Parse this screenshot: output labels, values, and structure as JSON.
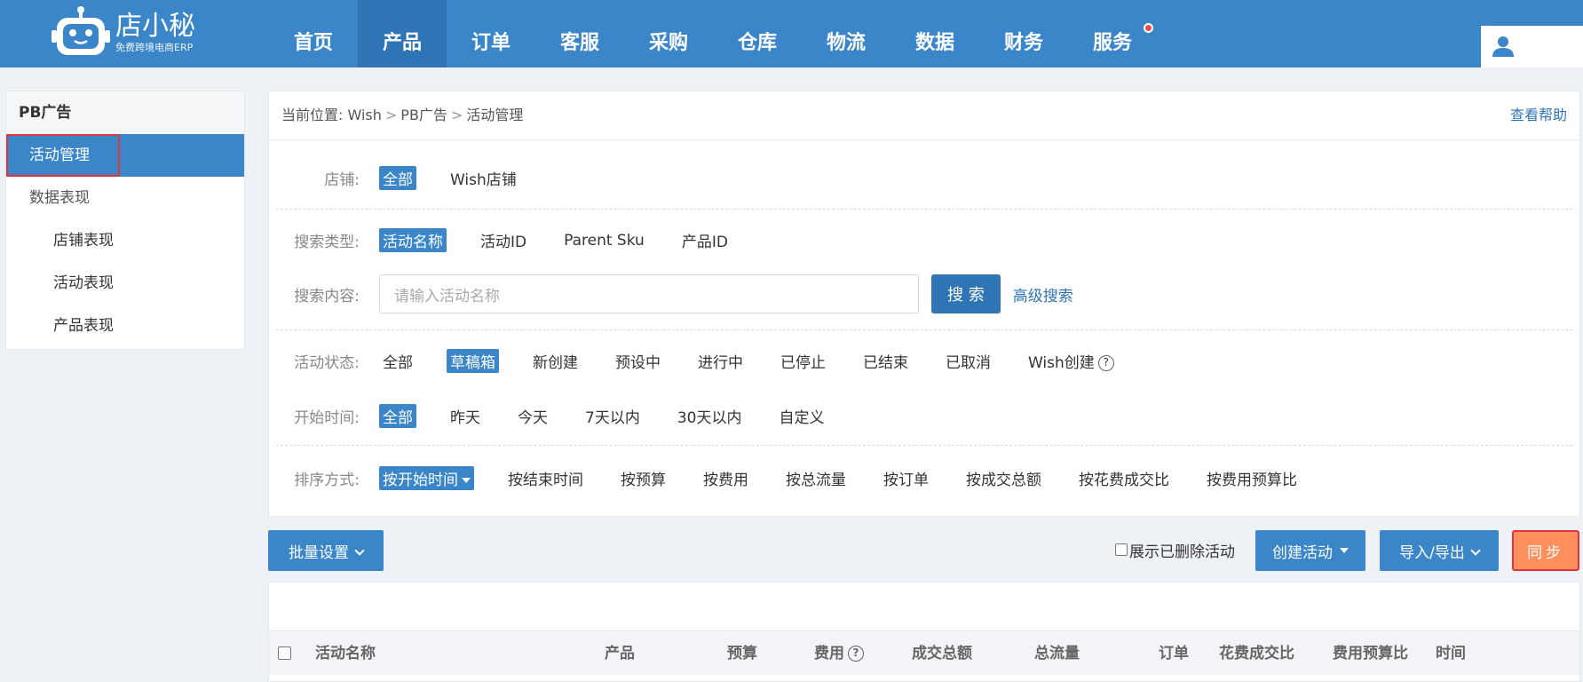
{
  "brand": {
    "name": "店小秘",
    "tagline": "免费跨境电商ERP"
  },
  "nav": {
    "items": [
      {
        "label": "首页"
      },
      {
        "label": "产品",
        "active": true
      },
      {
        "label": "订单"
      },
      {
        "label": "客服"
      },
      {
        "label": "采购"
      },
      {
        "label": "仓库"
      },
      {
        "label": "物流"
      },
      {
        "label": "数据"
      },
      {
        "label": "财务"
      },
      {
        "label": "服务",
        "badge_dot": true
      }
    ]
  },
  "sidebar": {
    "title": "PB广告",
    "items": [
      {
        "label": "活动管理",
        "active": true
      },
      {
        "label": "数据表现"
      },
      {
        "label": "店铺表现"
      },
      {
        "label": "活动表现"
      },
      {
        "label": "产品表现"
      }
    ]
  },
  "breadcrumb": {
    "prefix": "当前位置:",
    "items": [
      "Wish",
      "PB广告",
      "活动管理"
    ],
    "help": "查看帮助"
  },
  "filters": {
    "store": {
      "label": "店铺:",
      "options": [
        "全部",
        "Wish店铺"
      ],
      "selected": "全部"
    },
    "search_type": {
      "label": "搜索类型:",
      "options": [
        "活动名称",
        "活动ID",
        "Parent Sku",
        "产品ID"
      ],
      "selected": "活动名称"
    },
    "search_content": {
      "label": "搜索内容:",
      "placeholder": "请输入活动名称",
      "button": "搜 索",
      "advanced": "高级搜索"
    },
    "status": {
      "label": "活动状态:",
      "options": [
        "全部",
        "草稿箱",
        "新创建",
        "预设中",
        "进行中",
        "已停止",
        "已结束",
        "已取消",
        "Wish创建"
      ],
      "selected": "草稿箱"
    },
    "start_time": {
      "label": "开始时间:",
      "options": [
        "全部",
        "昨天",
        "今天",
        "7天以内",
        "30天以内",
        "自定义"
      ],
      "selected": "全部"
    },
    "sort": {
      "label": "排序方式:",
      "options": [
        "按开始时间",
        "按结束时间",
        "按预算",
        "按费用",
        "按总流量",
        "按订单",
        "按成交总额",
        "按花费成交比",
        "按费用预算比"
      ],
      "selected": "按开始时间"
    }
  },
  "actions": {
    "batch": "批量设置",
    "show_deleted": "展示已删除活动",
    "create": "创建活动",
    "import_export": "导入/导出",
    "sync": "同步"
  },
  "table": {
    "columns": [
      "活动名称",
      "产品",
      "预算",
      "费用",
      "成交总额",
      "总流量",
      "订单",
      "花费成交比",
      "费用预算比",
      "时间"
    ]
  },
  "colors": {
    "brand_blue": "#3a86c8",
    "nav_active": "#2f74b4",
    "sync_orange": "#ff8f5c",
    "highlight_red": "#e0343c"
  }
}
